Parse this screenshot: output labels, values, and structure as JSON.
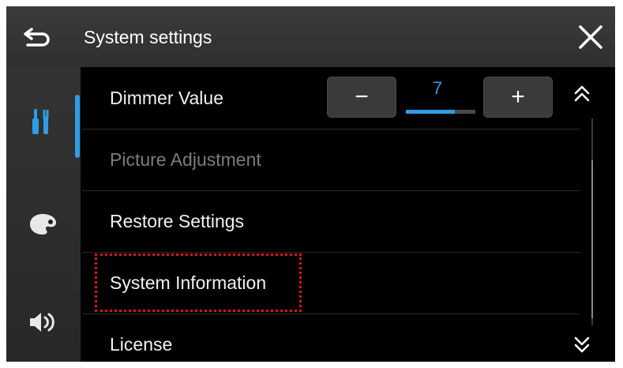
{
  "header": {
    "title": "System settings",
    "back_icon": "back-arrow-icon",
    "close_icon": "close-icon"
  },
  "sidebar": {
    "items": [
      {
        "icon": "tools-icon",
        "active": true
      },
      {
        "icon": "palette-icon",
        "active": false
      },
      {
        "icon": "speaker-icon",
        "active": false
      }
    ]
  },
  "settings": {
    "dimmer": {
      "label": "Dimmer Value",
      "value": "7",
      "minus_label": "−",
      "plus_label": "+",
      "level_fraction": 0.7
    },
    "picture_adjustment": {
      "label": "Picture Adjustment",
      "enabled": false
    },
    "restore_settings": {
      "label": "Restore Settings"
    },
    "system_information": {
      "label": "System Information"
    },
    "license": {
      "label": "License"
    }
  },
  "scroll": {
    "up_icon": "double-chevron-up-icon",
    "down_icon": "double-chevron-down-icon"
  },
  "colors": {
    "accent": "#2f9ce6",
    "highlight": "#e01313",
    "background": "#000000"
  }
}
